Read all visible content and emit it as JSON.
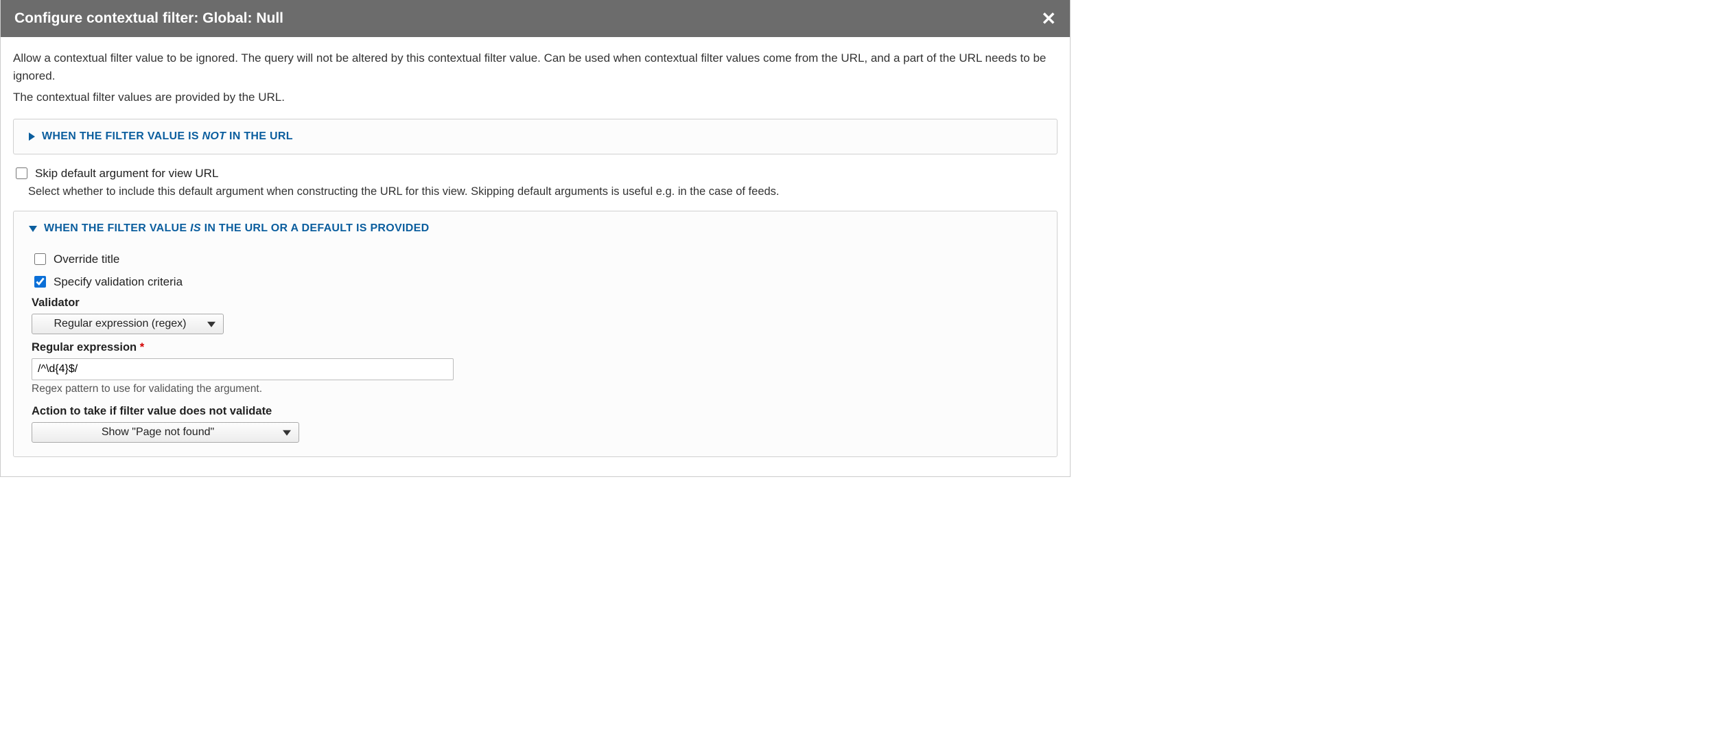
{
  "header": {
    "title": "Configure contextual filter: Global: Null"
  },
  "description": {
    "line1": "Allow a contextual filter value to be ignored. The query will not be altered by this contextual filter value. Can be used when contextual filter values come from the URL, and a part of the URL needs to be ignored.",
    "line2": "The contextual filter values are provided by the URL."
  },
  "section_not_in_url": {
    "title_pre": "WHEN THE FILTER VALUE IS ",
    "title_emph": "NOT",
    "title_post": " IN THE URL"
  },
  "skip_default": {
    "label": "Skip default argument for view URL",
    "help": "Select whether to include this default argument when constructing the URL for this view. Skipping default arguments is useful e.g. in the case of feeds."
  },
  "section_in_url": {
    "title_pre": "WHEN THE FILTER VALUE ",
    "title_emph": "IS",
    "title_post": " IN THE URL OR A DEFAULT IS PROVIDED"
  },
  "override_title": {
    "label": "Override title"
  },
  "specify_validation": {
    "label": "Specify validation criteria"
  },
  "validator": {
    "label": "Validator",
    "selected": "Regular expression (regex)"
  },
  "regex": {
    "label": "Regular expression",
    "value": "/^\\d{4}$/",
    "help": "Regex pattern to use for validating the argument."
  },
  "action_invalid": {
    "label": "Action to take if filter value does not validate",
    "selected": "Show \"Page not found\""
  }
}
